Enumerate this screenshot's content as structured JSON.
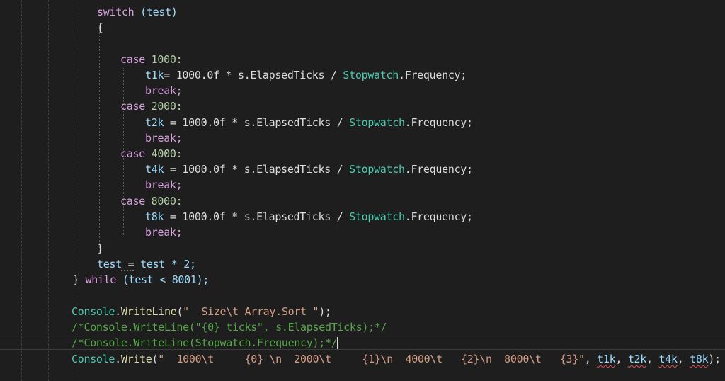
{
  "editor": {
    "lines": {
      "switch_kw": "switch",
      "switch_rest": " (test)",
      "open_brace": "{",
      "case1_kw": "case",
      "case1_val": " 1000:",
      "t1k_var": "t1k",
      "t1k_rest": "= 1000.0f * s.ElapsedTicks / ",
      "t1k_type": "Stopwatch",
      "t1k_end": ".Frequency;",
      "break1": "break;",
      "case2_kw": "case",
      "case2_val": " 2000:",
      "t2k_var": "t2k",
      "t2k_rest": " = 1000.0f * s.ElapsedTicks / ",
      "t2k_type": "Stopwatch",
      "t2k_end": ".Frequency;",
      "break2": "break;",
      "case3_kw": "case",
      "case3_val": " 4000:",
      "t4k_var": "t4k",
      "t4k_rest": " = 1000.0f * s.ElapsedTicks / ",
      "t4k_type": "Stopwatch",
      "t4k_end": ".Frequency;",
      "break3": "break;",
      "case4_kw": "case",
      "case4_val": " 8000:",
      "t8k_var": "t8k",
      "t8k_rest": " = 1000.0f * s.ElapsedTicks / ",
      "t8k_type": "Stopwatch",
      "t8k_end": ".Frequency;",
      "break4": "break;",
      "close_brace": "}",
      "test_var": "test",
      "test_eq": " =",
      "test_rest": " test * 2;",
      "while_brace": "} ",
      "while_kw": "while",
      "while_rest": " (test < 8001);",
      "cw1_type": "Console",
      "cw1_dot": ".",
      "cw1_method": "WriteLine",
      "cw1_open": "(",
      "cw1_str": "\"  Size\\t Array.Sort \"",
      "cw1_close": ");",
      "comment1": "/*Console.WriteLine(\"{0} ticks\", s.ElapsedTicks);*/",
      "comment2": "/*Console.WriteLine(Stopwatch.Frequency);*/",
      "cw2_type": "Console",
      "cw2_dot": ".",
      "cw2_method": "Write",
      "cw2_open": "(",
      "cw2_str": "\"  1000\\t     {0} \\n  2000\\t     {1}\\n  4000\\t   {2}\\n  8000\\t   {3}\"",
      "cw2_comma": ", ",
      "cw2_a1": "t1k",
      "cw2_a2": "t2k",
      "cw2_a3": "t4k",
      "cw2_a4": "t8k",
      "cw2_sep": ", ",
      "cw2_close": ");"
    },
    "colors": {
      "background": "#1e1e1e",
      "keyword": "#d8a0df",
      "control_keyword": "#569cd6",
      "variable": "#9cdcfe",
      "type": "#4ec9b0",
      "string": "#d69d85",
      "comment": "#57a64a",
      "method": "#dcdcaa"
    }
  }
}
